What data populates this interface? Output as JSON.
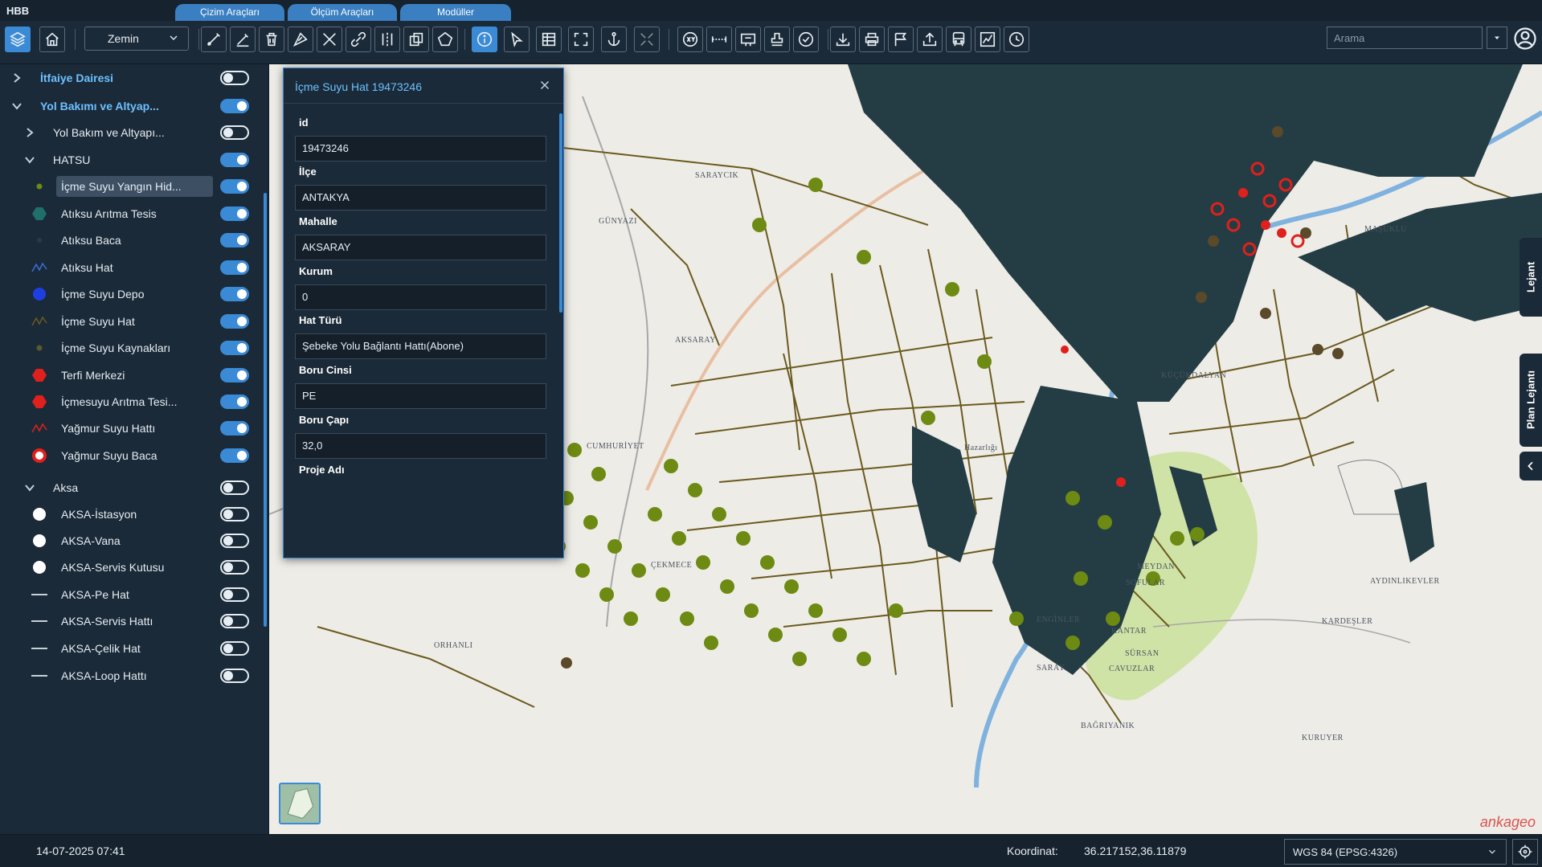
{
  "app": {
    "title": "HBB"
  },
  "top_tabs": [
    "Çizim Araçları",
    "Ölçüm Araçları",
    "Modüller"
  ],
  "toolbar": {
    "basemap_label": "Zemin",
    "search_placeholder": "Arama",
    "buttons": [
      "layers-icon",
      "home-icon",
      "draw-line-icon",
      "draw-edit-icon",
      "delete-icon",
      "measure-area-icon",
      "cut-icon",
      "link-icon",
      "split-icon",
      "copy-icon",
      "polygon-icon",
      "info-icon",
      "select-icon",
      "table-icon",
      "fullscreen-icon",
      "anchor-icon",
      "expand-icon",
      "xy-icon",
      "ruler-icon",
      "layout-icon",
      "stamp-icon",
      "check-icon",
      "download-icon",
      "print-icon",
      "flag-icon",
      "upload-icon",
      "bus-icon",
      "chart-icon",
      "history-icon"
    ]
  },
  "sidebar": {
    "layers": [
      {
        "label": "İtfaiye Dairesi",
        "level": 0,
        "group": true,
        "expanded": false,
        "on": false
      },
      {
        "label": "Yol Bakımı ve Altyap...",
        "level": 0,
        "group": true,
        "expanded": true,
        "on": true
      },
      {
        "label": "Yol Bakım ve Altyapı...",
        "level": 1,
        "group": false,
        "expanded": false,
        "chevron": true,
        "on": false
      },
      {
        "label": "HATSU",
        "level": 1,
        "group": false,
        "expanded": true,
        "chevron": true,
        "on": true
      },
      {
        "label": "İçme Suyu Yangın Hid...",
        "level": 2,
        "icon": "small-dot-olive",
        "on": true,
        "selected": true
      },
      {
        "label": "Atıksu Arıtma Tesis",
        "level": 2,
        "icon": "hexagon-teal",
        "on": true
      },
      {
        "label": "Atıksu Baca",
        "level": 2,
        "icon": "small-dot-dark",
        "on": true
      },
      {
        "label": "Atıksu Hat",
        "level": 2,
        "icon": "line-blue",
        "on": true
      },
      {
        "label": "İçme Suyu Depo",
        "level": 2,
        "icon": "circle-blue",
        "on": true
      },
      {
        "label": "İçme Suyu Hat",
        "level": 2,
        "icon": "line-olive",
        "on": true
      },
      {
        "label": "İçme Suyu Kaynakları",
        "level": 2,
        "icon": "small-dot-olive2",
        "on": true
      },
      {
        "label": "Terfi Merkezi",
        "level": 2,
        "icon": "hexagon-red",
        "on": true
      },
      {
        "label": "İçmesuyu Arıtma Tesi...",
        "level": 2,
        "icon": "hexagon-red",
        "on": true
      },
      {
        "label": "Yağmur Suyu Hattı",
        "level": 2,
        "icon": "line-red",
        "on": true
      },
      {
        "label": "Yağmur Suyu Baca",
        "level": 2,
        "icon": "ring-red",
        "on": true
      },
      {
        "label": "Aksa",
        "level": 1,
        "group": false,
        "expanded": true,
        "chevron": true,
        "on": false
      },
      {
        "label": "AKSA-İstasyon",
        "level": 2,
        "icon": "circle-white",
        "on": false
      },
      {
        "label": "AKSA-Vana",
        "level": 2,
        "icon": "circle-white",
        "on": false
      },
      {
        "label": "AKSA-Servis Kutusu",
        "level": 2,
        "icon": "circle-white",
        "on": false
      },
      {
        "label": "AKSA-Pe Hat",
        "level": 2,
        "icon": "line-white",
        "on": false
      },
      {
        "label": "AKSA-Servis Hattı",
        "level": 2,
        "icon": "line-white",
        "on": false
      },
      {
        "label": "AKSA-Çelik Hat",
        "level": 2,
        "icon": "line-white",
        "on": false
      },
      {
        "label": "AKSA-Loop Hattı",
        "level": 2,
        "icon": "line-white",
        "on": false
      }
    ]
  },
  "popup": {
    "title": "İçme Suyu Hat 19473246",
    "fields": [
      {
        "label": "id",
        "value": "19473246"
      },
      {
        "label": "İlçe",
        "value": "ANTAKYA"
      },
      {
        "label": "Mahalle",
        "value": "AKSARAY"
      },
      {
        "label": "Kurum",
        "value": "0"
      },
      {
        "label": "Hat Türü",
        "value": "Şebeke Yolu Bağlantı Hattı(Abone)"
      },
      {
        "label": "Boru Cinsi",
        "value": "PE"
      },
      {
        "label": "Boru Çapı",
        "value": "32,0"
      },
      {
        "label": "Proje Adı",
        "value": ""
      }
    ]
  },
  "map": {
    "places": [
      "SARAYCIK",
      "GÜNYAZI",
      "MAŞUKLU",
      "ORHANLI",
      "ÇEKMECE",
      "KÜÇÜKDALYAN",
      "AYDINLIKEVLER",
      "KARDEŞLER",
      "KANTAR",
      "SOFULAR",
      "ENGİNLER",
      "CAVUZLAR",
      "BAĞRIYANIK",
      "KURUYER",
      "MEYDAN",
      "SARAY",
      "SÜRSAN",
      "Hazarlığı",
      "AKSARAY",
      "CUMHURİYET"
    ],
    "brand": "ankageo",
    "colors": {
      "pipe": "#6b5a1e",
      "sewer_blob": "#243d44",
      "hydrant": "#6d8a12",
      "rain_red": "#e0201c",
      "river": "#6fa8dc",
      "park": "#c9dea2"
    }
  },
  "right_tabs": [
    "Lejant",
    "Plan Lejantı"
  ],
  "status": {
    "datetime": "14-07-2025 07:41",
    "coord_label": "Koordinat:",
    "coord_value": "36.217152,36.11879",
    "crs": "WGS 84 (EPSG:4326)"
  }
}
